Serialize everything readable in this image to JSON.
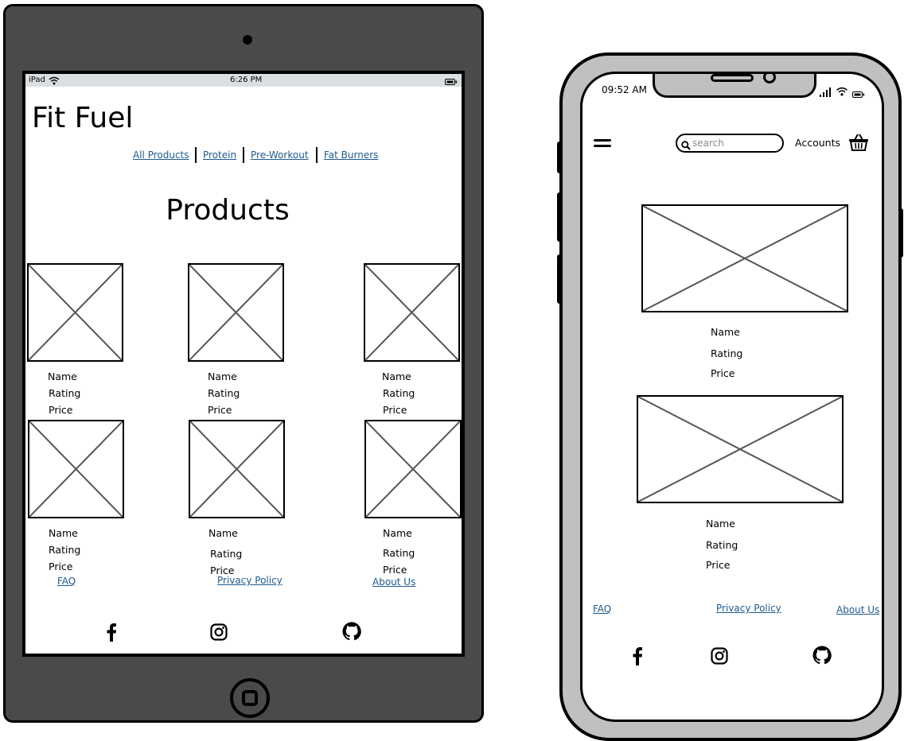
{
  "ipad": {
    "status": {
      "device": "iPad",
      "time": "6:26 PM"
    },
    "brand": "Fit Fuel",
    "nav": [
      "All Products",
      "Protein",
      "Pre-Workout",
      "Fat Burners"
    ],
    "heading": "Products",
    "products": [
      {
        "name": "Name",
        "rating": "Rating",
        "price": "Price"
      },
      {
        "name": "Name",
        "rating": "Rating",
        "price": "Price"
      },
      {
        "name": "Name",
        "rating": "Rating",
        "price": "Price"
      },
      {
        "name": "Name",
        "rating": "Rating",
        "price": "Price"
      },
      {
        "name": "Name",
        "rating": "Rating",
        "price": "Price"
      },
      {
        "name": "Name",
        "rating": "Rating",
        "price": "Price"
      }
    ],
    "footer": [
      "FAQ",
      "Privacy Policy",
      "About Us"
    ],
    "social": [
      "facebook-icon",
      "instagram-icon",
      "github-icon"
    ]
  },
  "iphone": {
    "time": "09:52 AM",
    "search_placeholder": "search",
    "accounts": "Accounts",
    "products": [
      {
        "name": "Name",
        "rating": "Rating",
        "price": "Price"
      },
      {
        "name": "Name",
        "rating": "Rating",
        "price": "Price"
      }
    ],
    "footer": [
      "FAQ",
      "Privacy Policy",
      "About Us"
    ],
    "social": [
      "facebook-icon",
      "instagram-icon",
      "github-icon"
    ]
  },
  "colors": {
    "link": "#1e5a8e",
    "device_frame": "#4a4a4a",
    "phone_frame": "#c0c0c0",
    "status_bar": "#dcdfe1"
  }
}
